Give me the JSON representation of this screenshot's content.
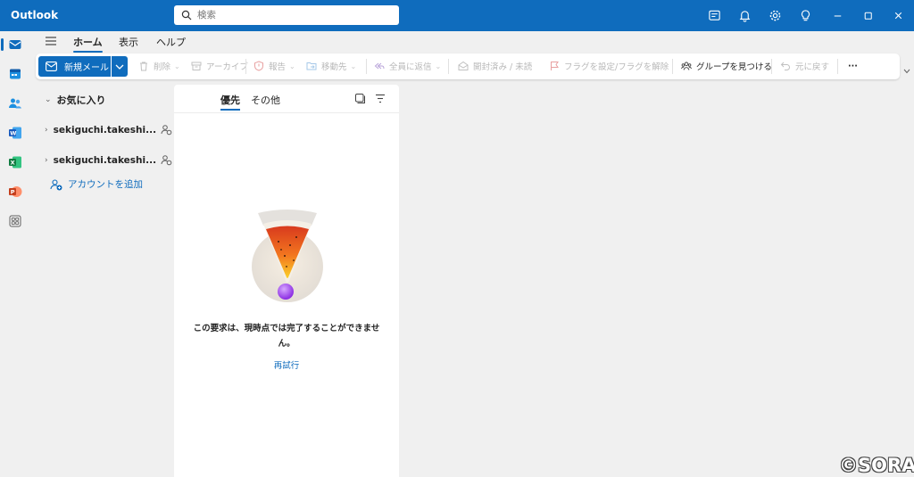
{
  "app": {
    "title": "Outlook"
  },
  "search": {
    "placeholder": "検索"
  },
  "titlebar_icons": [
    "sticky-notes-icon",
    "bell-icon",
    "gear-icon",
    "lightbulb-icon",
    "minimize-icon",
    "maximize-icon",
    "close-icon"
  ],
  "rail": [
    "mail-icon",
    "calendar-icon",
    "people-icon",
    "word-icon",
    "excel-icon",
    "powerpoint-icon",
    "apps-icon"
  ],
  "ribbon": {
    "tabs": [
      {
        "label": "ホーム",
        "active": true
      },
      {
        "label": "表示",
        "active": false
      },
      {
        "label": "ヘルプ",
        "active": false
      }
    ]
  },
  "toolbar": {
    "new_mail": "新規メール",
    "delete": "削除",
    "archive": "アーカイブ",
    "report": "報告",
    "move": "移動先",
    "reply_all": "全員に返信",
    "read_unread": "開封済み / 未読",
    "flag": "フラグを設定/フラグを解除",
    "find_groups": "グループを見つける",
    "undo": "元に戻す",
    "more": "···"
  },
  "folders": {
    "favorites": "お気に入り",
    "accounts": [
      {
        "name": "sekiguchi.takeshi..."
      },
      {
        "name": "sekiguchi.takeshi..."
      }
    ],
    "add_account": "アカウントを追加"
  },
  "list": {
    "tabs": [
      {
        "label": "優先",
        "active": true
      },
      {
        "label": "その他",
        "active": false
      }
    ],
    "error_message": "この要求は、現時点では完了することができません。",
    "retry": "再試行"
  },
  "watermark": "©SORA",
  "colors": {
    "accent": "#0f6cbd",
    "background": "#f0f0f0"
  }
}
